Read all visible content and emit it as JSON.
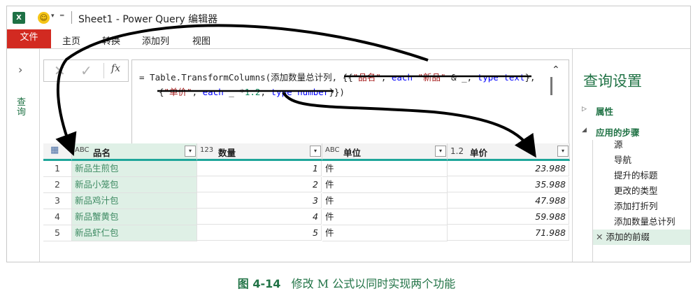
{
  "titlebar": {
    "app_icon_letter": "X",
    "title": "Sheet1 - Power Query 编辑器"
  },
  "ribbon": {
    "tabs": [
      "文件",
      "主页",
      "转换",
      "添加列",
      "视图"
    ]
  },
  "nav": {
    "label": "查询"
  },
  "formula": {
    "fx_label": "fx",
    "line1": "= Table.TransformColumns(添加数量总计列, {{\"品名\", each \"新品\" & _, type text},",
    "line2": "{\"单价\", each _ *1.2, type number}})"
  },
  "grid": {
    "columns": [
      {
        "type": "ABC",
        "name": "品名"
      },
      {
        "type": "123",
        "name": "数量"
      },
      {
        "type": "ABC",
        "name": "单位"
      },
      {
        "type": "1.2",
        "name": "单价"
      }
    ],
    "rows": [
      {
        "idx": "1",
        "name": "新品生煎包",
        "qty": "1",
        "unit": "件",
        "price": "23.988"
      },
      {
        "idx": "2",
        "name": "新品小笼包",
        "qty": "2",
        "unit": "件",
        "price": "35.988"
      },
      {
        "idx": "3",
        "name": "新品鸡汁包",
        "qty": "3",
        "unit": "件",
        "price": "47.988"
      },
      {
        "idx": "4",
        "name": "新品蟹黄包",
        "qty": "4",
        "unit": "件",
        "price": "59.988"
      },
      {
        "idx": "5",
        "name": "新品虾仁包",
        "qty": "5",
        "unit": "件",
        "price": "71.988"
      }
    ]
  },
  "settings": {
    "title": "查询设置",
    "properties_label": "属性",
    "steps_label": "应用的步骤",
    "steps": [
      "源",
      "导航",
      "提升的标题",
      "更改的类型",
      "添加打折列",
      "添加数量总计列",
      "添加的前缀"
    ],
    "selected_step_index": 6
  },
  "caption": {
    "number": "图 4-14",
    "text": "修改 M 公式以同时实现两个功能"
  },
  "colors": {
    "accent_green": "#217346",
    "file_tab_red": "#d22a21",
    "header_underline": "#1fa69a",
    "selected_column_bg": "#dff0e6"
  }
}
